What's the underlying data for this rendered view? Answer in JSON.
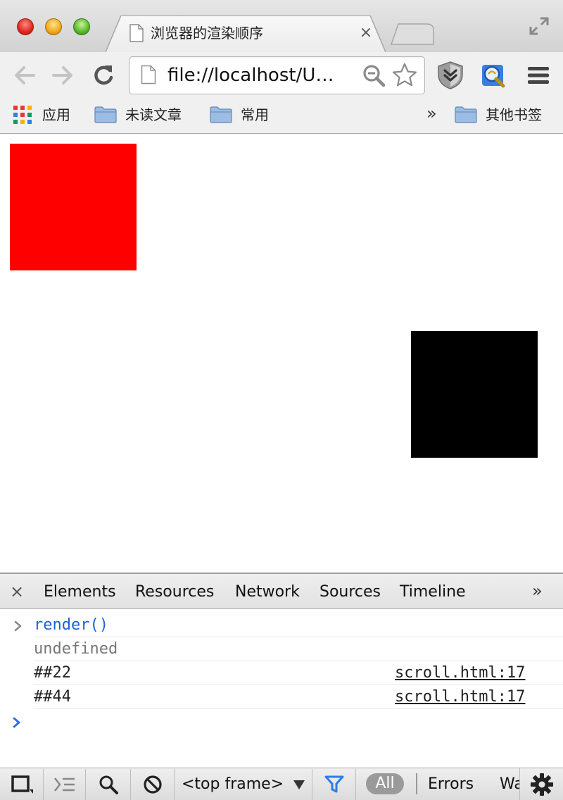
{
  "window": {
    "tab_title": "浏览器的渲染顺序",
    "tab_close_glyph": "×"
  },
  "omnibox": {
    "url": "file://localhost/U…"
  },
  "bookmarks": {
    "apps_label": "应用",
    "items": [
      {
        "label": "未读文章"
      },
      {
        "label": "常用"
      }
    ],
    "overflow_glyph": "»",
    "other_label": "其他书签"
  },
  "page": {
    "boxes": [
      {
        "color": "#ff0000"
      },
      {
        "color": "#000000"
      }
    ]
  },
  "devtools": {
    "close_glyph": "×",
    "tabs": [
      "Elements",
      "Resources",
      "Network",
      "Sources",
      "Timeline"
    ],
    "more_glyph": "»",
    "console": {
      "command": "render()",
      "result": "undefined",
      "logs": [
        {
          "text": "##22",
          "source": "scroll.html:17"
        },
        {
          "text": "##44",
          "source": "scroll.html:17"
        }
      ],
      "prompt_glyph": "›"
    },
    "statusbar": {
      "frame_select": "<top frame>",
      "filter_all": "All",
      "filter_errors": "Errors",
      "filter_warnings": "Wa"
    }
  },
  "colors": {
    "console_command": "#1a62d6",
    "console_result": "#777777",
    "prompt_active": "#2d6fe0",
    "filter_icon": "#2f7be8"
  }
}
